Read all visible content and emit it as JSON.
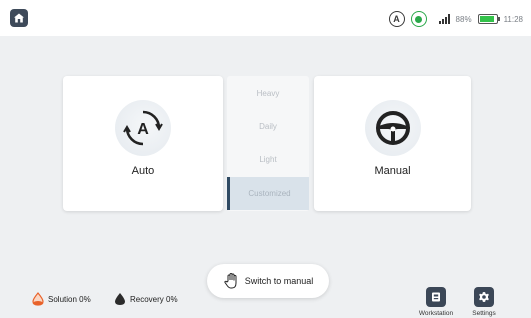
{
  "status": {
    "battery_text": "88%",
    "battery_level": 0.88,
    "time": "11:28",
    "mode_icon_letter": "A"
  },
  "modes": {
    "auto": {
      "label": "Auto",
      "icon": "auto-mode-icon"
    },
    "manual": {
      "label": "Manual",
      "icon": "steering-wheel-icon"
    }
  },
  "levels": [
    {
      "label": "Heavy"
    },
    {
      "label": "Daily"
    },
    {
      "label": "Light"
    },
    {
      "label": "Customized",
      "selected": true
    }
  ],
  "switch_button": {
    "label": "Switch to manual",
    "icon": "hand-icon"
  },
  "tanks": {
    "solution": {
      "label": "Solution 0%"
    },
    "recovery": {
      "label": "Recovery 0%"
    }
  },
  "nav": {
    "workstation": {
      "label": "Workstation",
      "icon": "workstation-icon"
    },
    "settings": {
      "label": "Settings",
      "icon": "gear-icon"
    }
  },
  "colors": {
    "accent": "#2f4a63",
    "nav_button": "#3b4757",
    "battery": "#33c24a",
    "solution": "#e8622a"
  }
}
